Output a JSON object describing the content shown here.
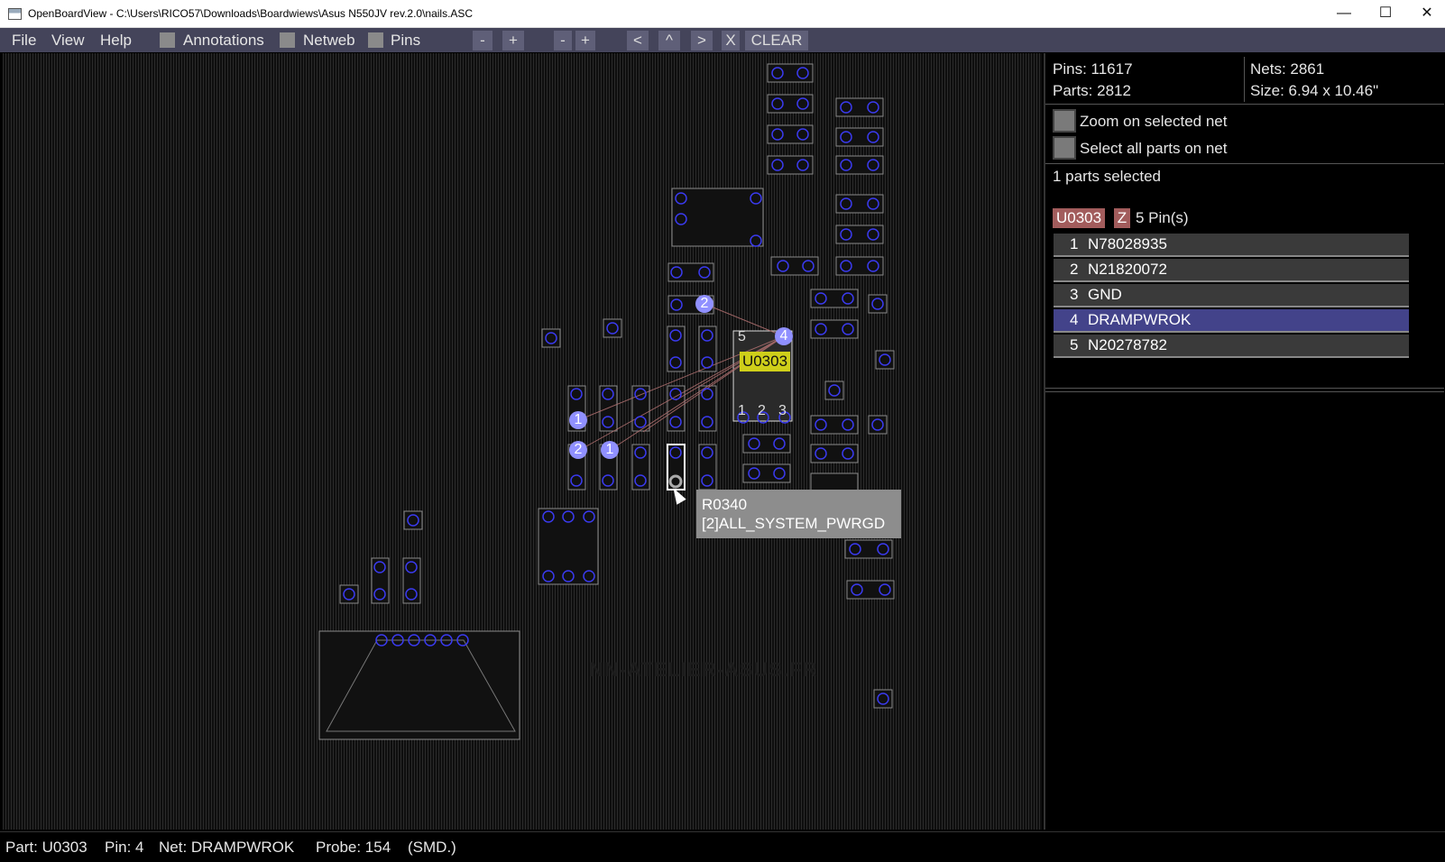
{
  "window": {
    "title": "OpenBoardView - C:\\Users\\RICO57\\Downloads\\Boardwiews\\Asus N550JV rev.2.0\\nails.ASC",
    "minimize_glyph": "—",
    "maximize_glyph": "☐",
    "close_glyph": "✕"
  },
  "menu": {
    "file": "File",
    "view": "View",
    "help": "Help",
    "annotations": "Annotations",
    "netweb": "Netweb",
    "pins": "Pins",
    "zoom_minus_1": "-",
    "zoom_plus_1": "+",
    "zoom_minus_2": "-",
    "zoom_plus_2": "+",
    "nav_left": "<",
    "nav_up": "^",
    "nav_right": ">",
    "clear_x": "X",
    "clear": "CLEAR"
  },
  "info": {
    "pins": "Pins: 11617",
    "parts": "Parts: 2812",
    "nets": "Nets: 2861",
    "size": "Size: 6.94 x 10.46\"",
    "zoom_on_net": "Zoom on selected net",
    "select_all_on_net": "Select all parts on net",
    "selected_count": "1 parts selected"
  },
  "part": {
    "name": "U0303",
    "z_label": "Z",
    "pin_count": "5 Pin(s)",
    "pins": [
      {
        "num": "1",
        "net": "N78028935",
        "selected": false
      },
      {
        "num": "2",
        "net": "N21820072",
        "selected": false
      },
      {
        "num": "3",
        "net": "GND",
        "selected": false
      },
      {
        "num": "4",
        "net": "DRAMPWROK",
        "selected": true
      },
      {
        "num": "5",
        "net": "N20278782",
        "selected": false
      }
    ]
  },
  "board": {
    "annotation_label": "U0303",
    "tooltip_part": "R0340",
    "tooltip_net": "[2]ALL_SYSTEM_PWRGD",
    "watermark": "NN-ATELIER-ASUS.FR",
    "chip_pin_5": "5",
    "chip_pin_4": "4",
    "chip_pin_1": "1",
    "chip_pin_2": "2",
    "chip_pin_3": "3",
    "net_pin_a": "2",
    "net_pin_b": "1",
    "net_pin_c": "2",
    "net_pin_d": "1"
  },
  "status": {
    "part": "Part: U0303",
    "pin": "Pin: 4",
    "net": "Net: DRAMPWROK",
    "probe": "Probe: 154",
    "type": "(SMD.)"
  },
  "colors": {
    "menubar_bg": "#44445a",
    "selected_row": "#43438a",
    "part_badge": "#a25c5c",
    "pin_circle": "#3a3aee",
    "net_pin_highlight": "#9090ff",
    "annotation_yellow": "#cfcf1a"
  }
}
